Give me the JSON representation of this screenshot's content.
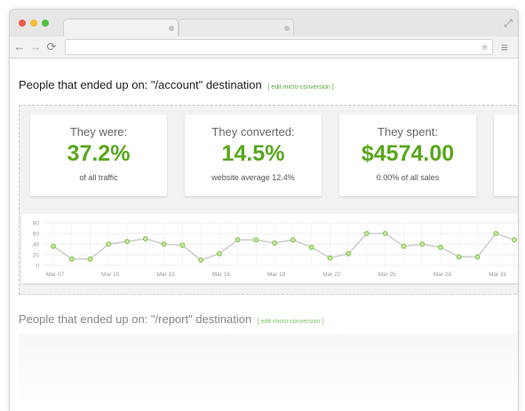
{
  "sections": [
    {
      "title": "People that ended up on: \"/account\" destination",
      "edit_label": "[ edit micro-conversion ]",
      "cards": [
        {
          "label": "They were:",
          "value": "37.2%",
          "sub": "of all traffic"
        },
        {
          "label": "They converted:",
          "value": "14.5%",
          "sub": "website average 12.4%"
        },
        {
          "label": "They spent:",
          "value": "$4574.00",
          "sub": "0.00% of all sales"
        }
      ]
    },
    {
      "title": "People that ended up on: \"/report\" destination",
      "edit_label": "[ edit micro-conversion ]"
    }
  ],
  "colors": {
    "accent_green": "#58a71d",
    "line_gray": "#cccccc",
    "point_fill": "#c8e6a0",
    "point_stroke": "#7cc242"
  },
  "chart_data": {
    "type": "line",
    "y_ticks": [
      "80",
      "60",
      "40",
      "20",
      "0"
    ],
    "ylim": [
      0,
      80
    ],
    "x_tick_labels": [
      "Mar 07",
      "Mar 10",
      "Mar 13",
      "Mar 16",
      "Mar 19",
      "Mar 22",
      "Mar 25",
      "Mar 28",
      "Mar 31"
    ],
    "grid": true,
    "series": [
      {
        "values": [
          36,
          12,
          12,
          40,
          45,
          50,
          40,
          38,
          10,
          22,
          48,
          48,
          42,
          48,
          34,
          14,
          22,
          60,
          60,
          36,
          40,
          34,
          16,
          16,
          60,
          48
        ]
      }
    ]
  },
  "icons": {
    "back": "←",
    "forward": "→",
    "reload": "⟳",
    "star": "★",
    "menu": "≡",
    "fullscreen": "⤢"
  }
}
